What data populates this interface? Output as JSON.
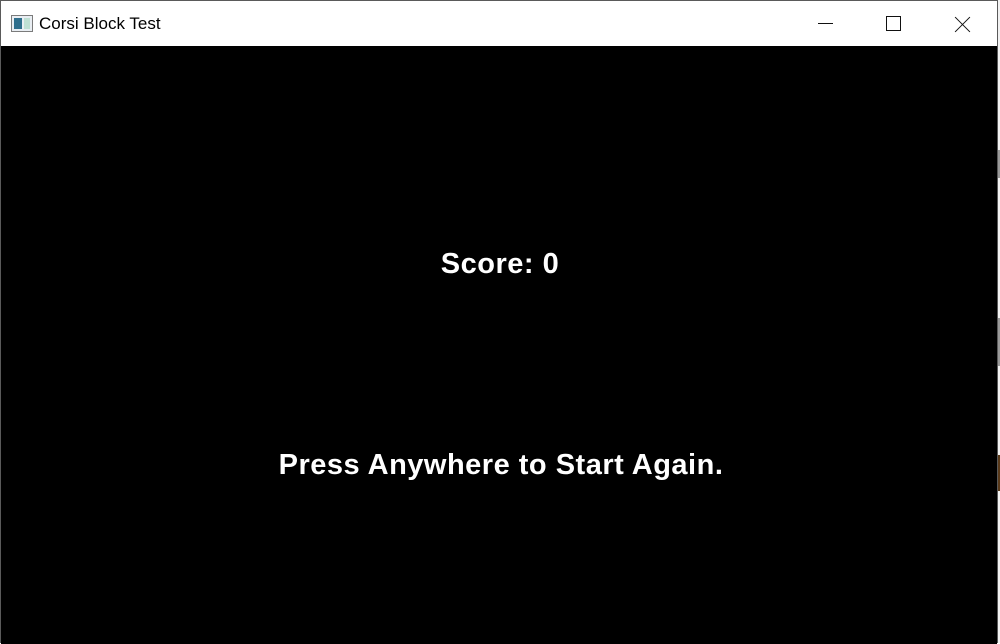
{
  "window": {
    "title": "Corsi Block Test",
    "icon": "application-window-icon",
    "controls": {
      "minimize_icon": "minimize-icon",
      "maximize_icon": "maximize-icon",
      "close_icon": "close-icon"
    }
  },
  "game": {
    "score_text": "Score: 0",
    "prompt_text": "Press Anywhere to Start Again.",
    "background_color": "#000000",
    "text_color": "#ffffff"
  }
}
